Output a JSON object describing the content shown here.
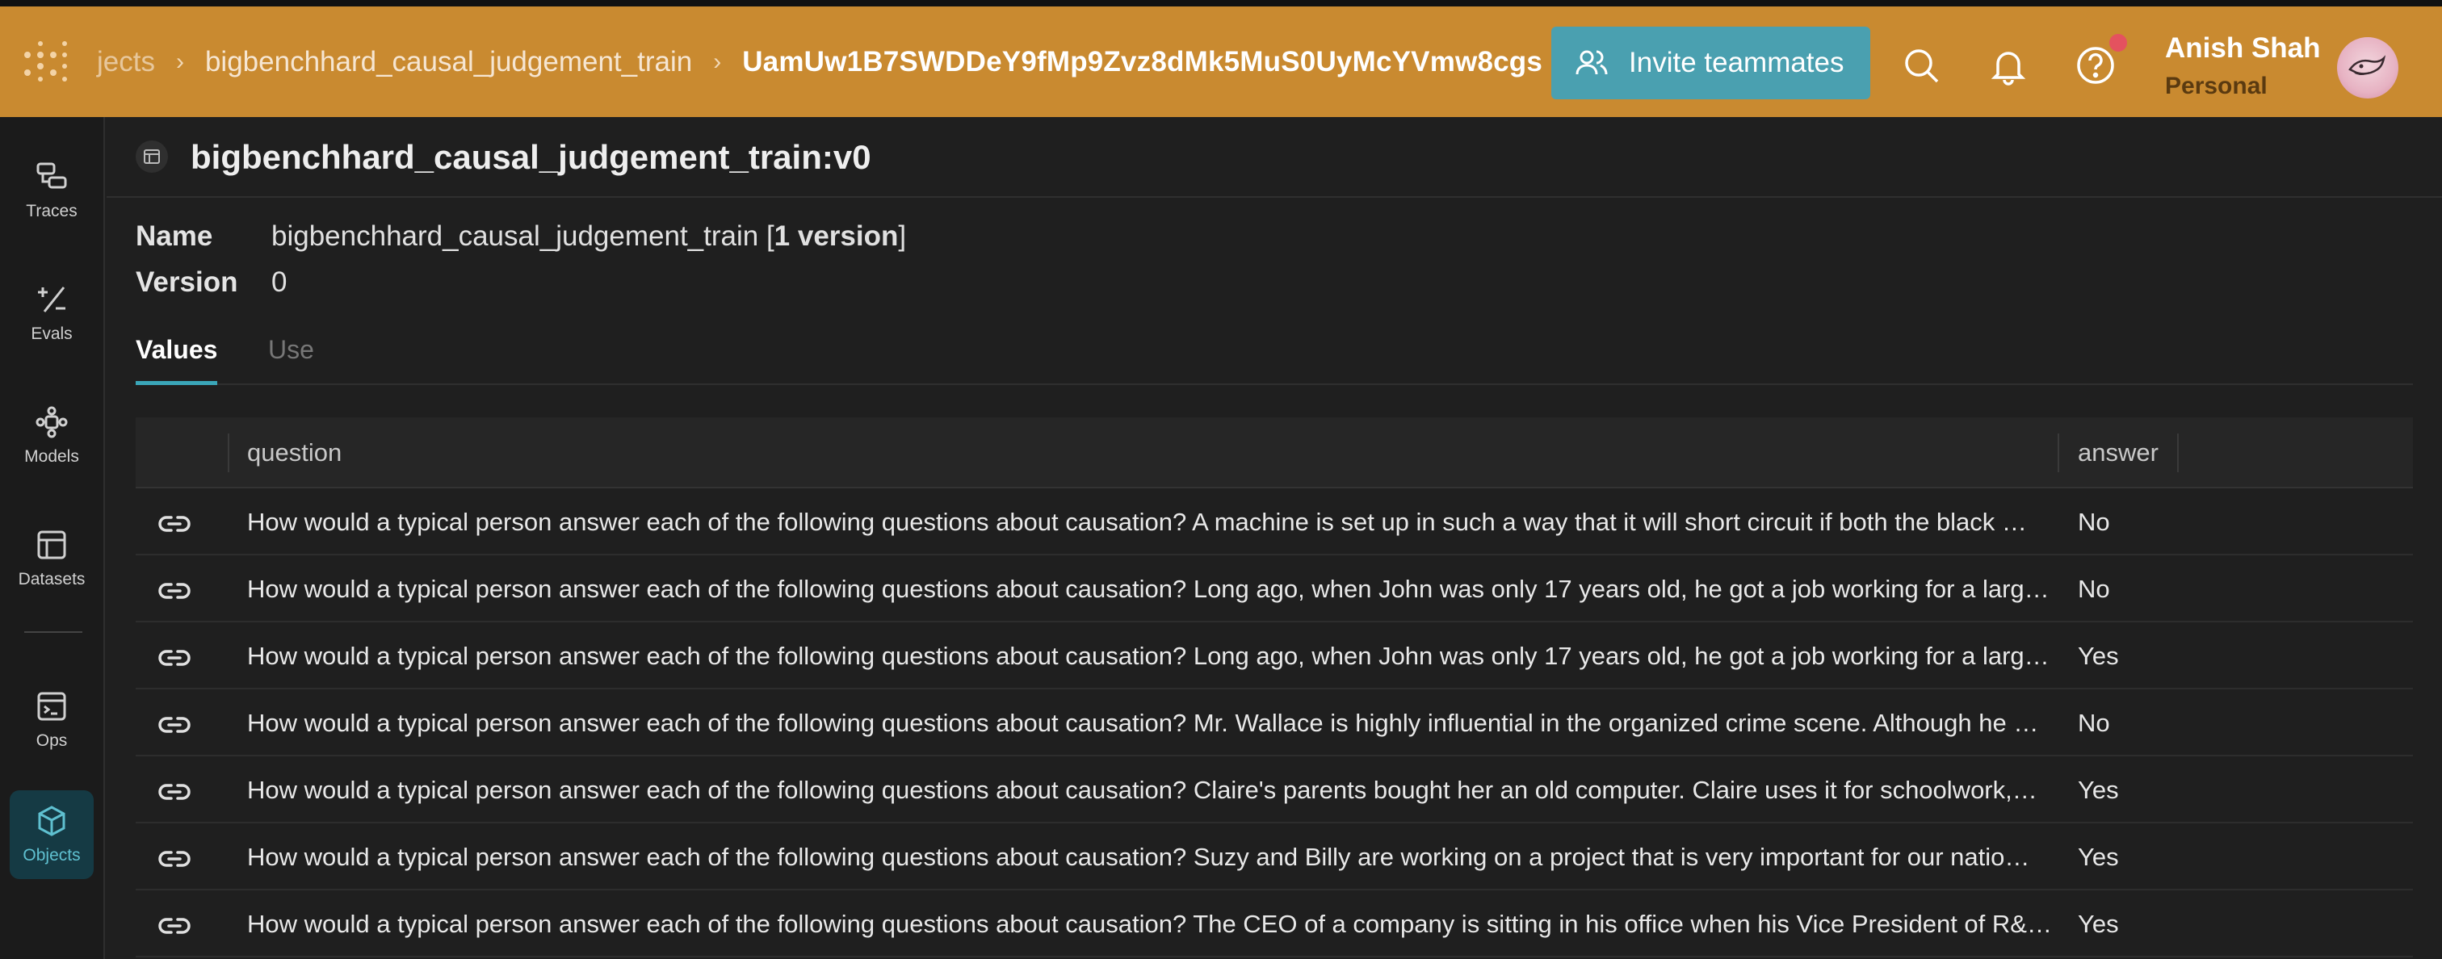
{
  "colors": {
    "header_bg": "#c98a30",
    "invite_bg": "#4aa0b0",
    "accent": "#3aa6b8",
    "active_sidebar_bg": "#153a44",
    "notification_dot": "#e4525f"
  },
  "header": {
    "breadcrumb": [
      "jects",
      "bigbenchhard_causal_judgement_train",
      "UamUw1B7SWDDeY9fMp9Zvz8dMk5MuS0UyMcYVmw8cgs"
    ],
    "invite_label": "Invite teammates",
    "icons": [
      "search-icon",
      "bell-icon",
      "help-icon"
    ],
    "user": {
      "name": "Anish Shah",
      "subtitle": "Personal"
    }
  },
  "sidebar": {
    "items": [
      {
        "label": "Traces",
        "icon": "traces-icon"
      },
      {
        "label": "Evals",
        "icon": "evals-icon"
      },
      {
        "label": "Models",
        "icon": "models-icon"
      },
      {
        "label": "Datasets",
        "icon": "datasets-icon"
      },
      {
        "label": "Ops",
        "icon": "ops-icon"
      },
      {
        "label": "Objects",
        "icon": "objects-icon",
        "active": true
      }
    ]
  },
  "page": {
    "title": "bigbenchhard_causal_judgement_train:v0",
    "name_label": "Name",
    "name_value": "bigbenchhard_causal_judgement_train [",
    "name_versions": "1 version",
    "name_suffix": "]",
    "version_label": "Version",
    "version_value": "0",
    "tabs": [
      "Values",
      "Use"
    ],
    "active_tab": "Values"
  },
  "table": {
    "columns": [
      "question",
      "answer"
    ],
    "rows": [
      {
        "question": "How would a typical person answer each of the following questions about causation? A machine is set up in such a way that it will short circuit if both the black …",
        "answer": "No"
      },
      {
        "question": "How would a typical person answer each of the following questions about causation? Long ago, when John was only 17 years old, he got a job working for a larg…",
        "answer": "No"
      },
      {
        "question": "How would a typical person answer each of the following questions about causation? Long ago, when John was only 17 years old, he got a job working for a larg…",
        "answer": "Yes"
      },
      {
        "question": "How would a typical person answer each of the following questions about causation? Mr. Wallace is highly influential in the organized crime scene. Although he …",
        "answer": "No"
      },
      {
        "question": "How would a typical person answer each of the following questions about causation? Claire's parents bought her an old computer. Claire uses it for schoolwork,…",
        "answer": "Yes"
      },
      {
        "question": "How would a typical person answer each of the following questions about causation? Suzy and Billy are working on a project that is very important for our natio…",
        "answer": "Yes"
      },
      {
        "question": "How would a typical person answer each of the following questions about causation? The CEO of a company is sitting in his office when his Vice President of R&…",
        "answer": "Yes"
      }
    ]
  }
}
